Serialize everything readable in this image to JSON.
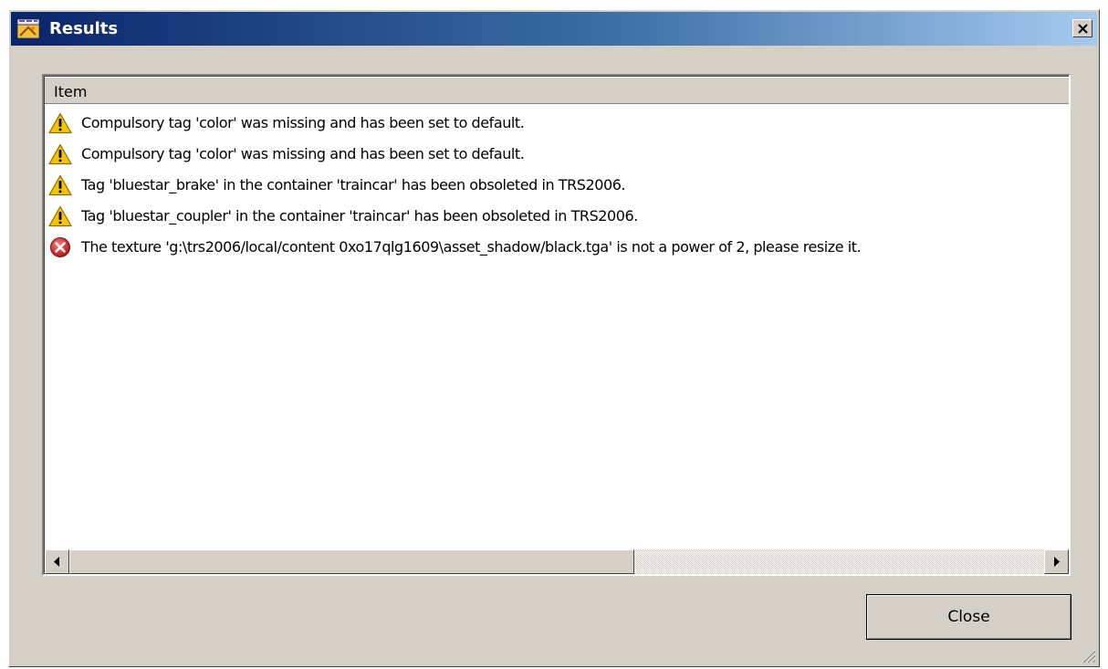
{
  "window": {
    "title": "Results",
    "app_icon": "app-icon",
    "close_icon": "close-x-icon",
    "title_gradient": [
      "#0a246a",
      "#3a6ea5",
      "#a6caf0"
    ]
  },
  "list": {
    "column_header": "Item",
    "rows": [
      {
        "severity": "warning",
        "icon": "warning-icon",
        "text": "Compulsory tag 'color' was missing and has been set to default."
      },
      {
        "severity": "warning",
        "icon": "warning-icon",
        "text": "Compulsory tag 'color' was missing and has been set to default."
      },
      {
        "severity": "warning",
        "icon": "warning-icon",
        "text": "Tag 'bluestar_brake' in the container 'traincar' has been obsoleted in TRS2006."
      },
      {
        "severity": "warning",
        "icon": "warning-icon",
        "text": "Tag 'bluestar_coupler' in the container 'traincar' has been obsoleted in TRS2006."
      },
      {
        "severity": "error",
        "icon": "error-icon",
        "text": "The texture 'g:\\trs2006/local/content 0xo17qlg1609\\asset_shadow/black.tga' is not a power of 2, please resize it."
      }
    ],
    "horizontal_scroll_fraction": 0.0,
    "thumb_visible_fraction": 0.58
  },
  "footer": {
    "close_label": "Close"
  },
  "colors": {
    "face": "#d4d0c8",
    "warning": "#f5c400",
    "error": "#d42a2a"
  }
}
